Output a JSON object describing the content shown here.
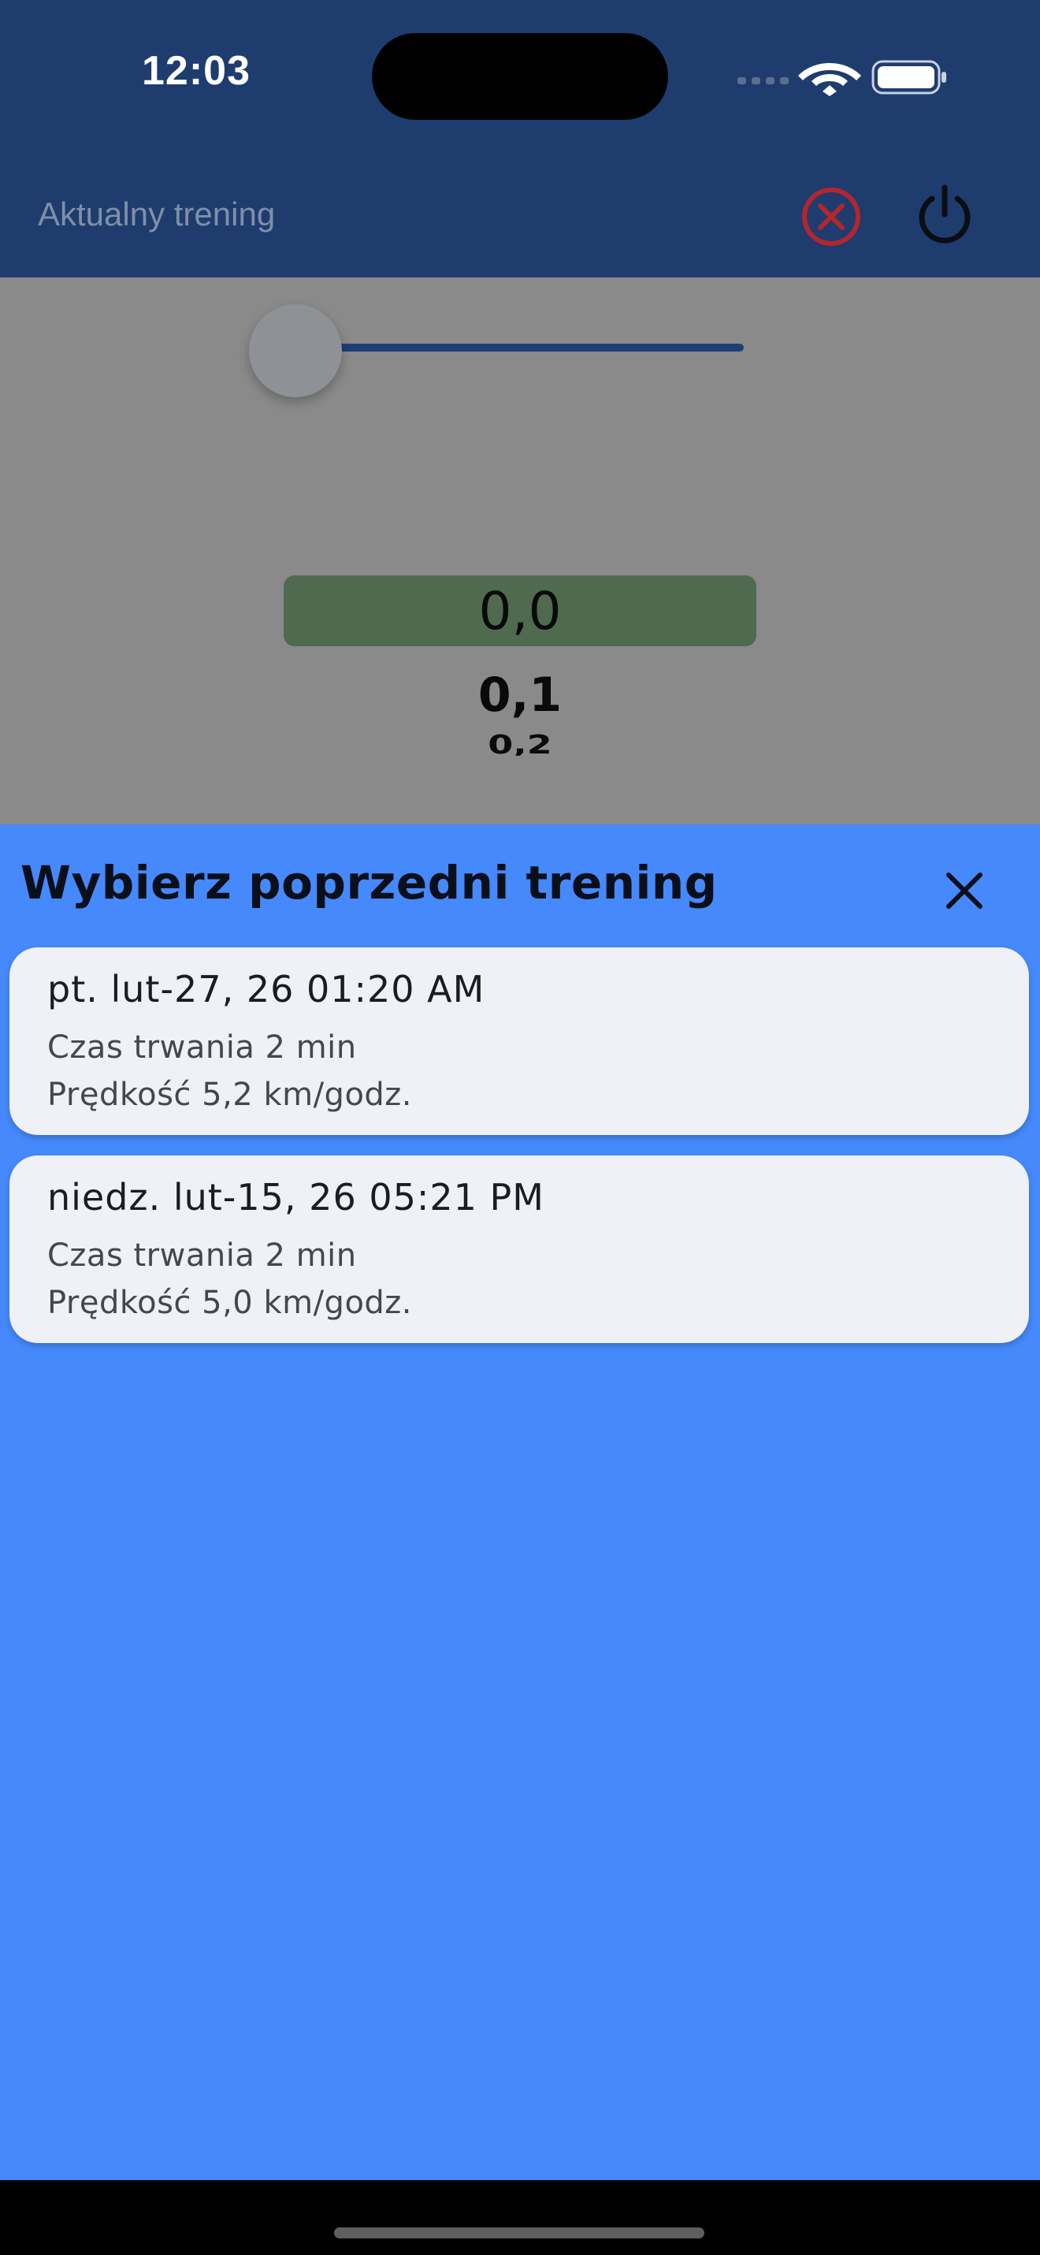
{
  "status_bar": {
    "time": "12:03",
    "icons": [
      "cellular-signal-icon",
      "wifi-icon",
      "battery-icon"
    ]
  },
  "app_bar": {
    "title": "Aktualny trening",
    "actions": [
      "cancel-circle-icon",
      "power-icon"
    ],
    "colors": {
      "background": "#1e3c6e",
      "cancel": "#b3262c"
    }
  },
  "speed_slider": {
    "value_fraction": 0.0
  },
  "speed_picker": {
    "values": [
      "0,0",
      "0,1",
      "0,2"
    ],
    "selected": "0,0"
  },
  "sheet": {
    "title": "Wybierz poprzedni trening",
    "background": "#4589fc",
    "items": [
      {
        "date": "pt. lut-27, 26 01:20 AM",
        "duration": "Czas trwania 2 min",
        "speed": "Prędkość 5,2 km/godz."
      },
      {
        "date": "niedz. lut-15, 26 05:21 PM",
        "duration": "Czas trwania 2 min",
        "speed": "Prędkość 5,0 km/godz."
      }
    ]
  }
}
